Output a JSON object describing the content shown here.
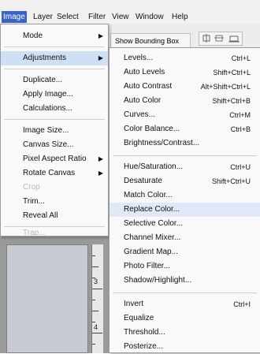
{
  "menubar": [
    "Image",
    "Layer",
    "Select",
    "Filter",
    "View",
    "Window",
    "Help"
  ],
  "options": {
    "show_bounding_box": "Show Bounding Box"
  },
  "image_menu": {
    "items": [
      {
        "label": "Mode",
        "submenu": true
      },
      {
        "label": "Adjustments",
        "submenu": true,
        "highlight": true
      },
      {
        "label": "Duplicate..."
      },
      {
        "label": "Apply Image..."
      },
      {
        "label": "Calculations..."
      },
      {
        "label": "Image Size..."
      },
      {
        "label": "Canvas Size..."
      },
      {
        "label": "Pixel Aspect Ratio",
        "submenu": true
      },
      {
        "label": "Rotate Canvas",
        "submenu": true
      },
      {
        "label": "Crop",
        "disabled": true
      },
      {
        "label": "Trim..."
      },
      {
        "label": "Reveal All"
      },
      {
        "label": "Trap...",
        "disabled": true
      }
    ]
  },
  "adjustments_menu": {
    "items": [
      {
        "label": "Levels...",
        "shortcut": "Ctrl+L"
      },
      {
        "label": "Auto Levels",
        "shortcut": "Shift+Ctrl+L"
      },
      {
        "label": "Auto Contrast",
        "shortcut": "Alt+Shift+Ctrl+L"
      },
      {
        "label": "Auto Color",
        "shortcut": "Shift+Ctrl+B"
      },
      {
        "label": "Curves...",
        "shortcut": "Ctrl+M"
      },
      {
        "label": "Color Balance...",
        "shortcut": "Ctrl+B"
      },
      {
        "label": "Brightness/Contrast..."
      },
      {
        "label": "Hue/Saturation...",
        "shortcut": "Ctrl+U"
      },
      {
        "label": "Desaturate",
        "shortcut": "Shift+Ctrl+U"
      },
      {
        "label": "Match Color..."
      },
      {
        "label": "Replace Color...",
        "hover": true
      },
      {
        "label": "Selective Color..."
      },
      {
        "label": "Channel Mixer..."
      },
      {
        "label": "Gradient Map..."
      },
      {
        "label": "Photo Filter..."
      },
      {
        "label": "Shadow/Highlight..."
      },
      {
        "label": "Invert",
        "shortcut": "Ctrl+I"
      },
      {
        "label": "Equalize"
      },
      {
        "label": "Threshold..."
      },
      {
        "label": "Posterize..."
      }
    ]
  },
  "ruler": {
    "numbers": [
      "3",
      "4"
    ]
  }
}
